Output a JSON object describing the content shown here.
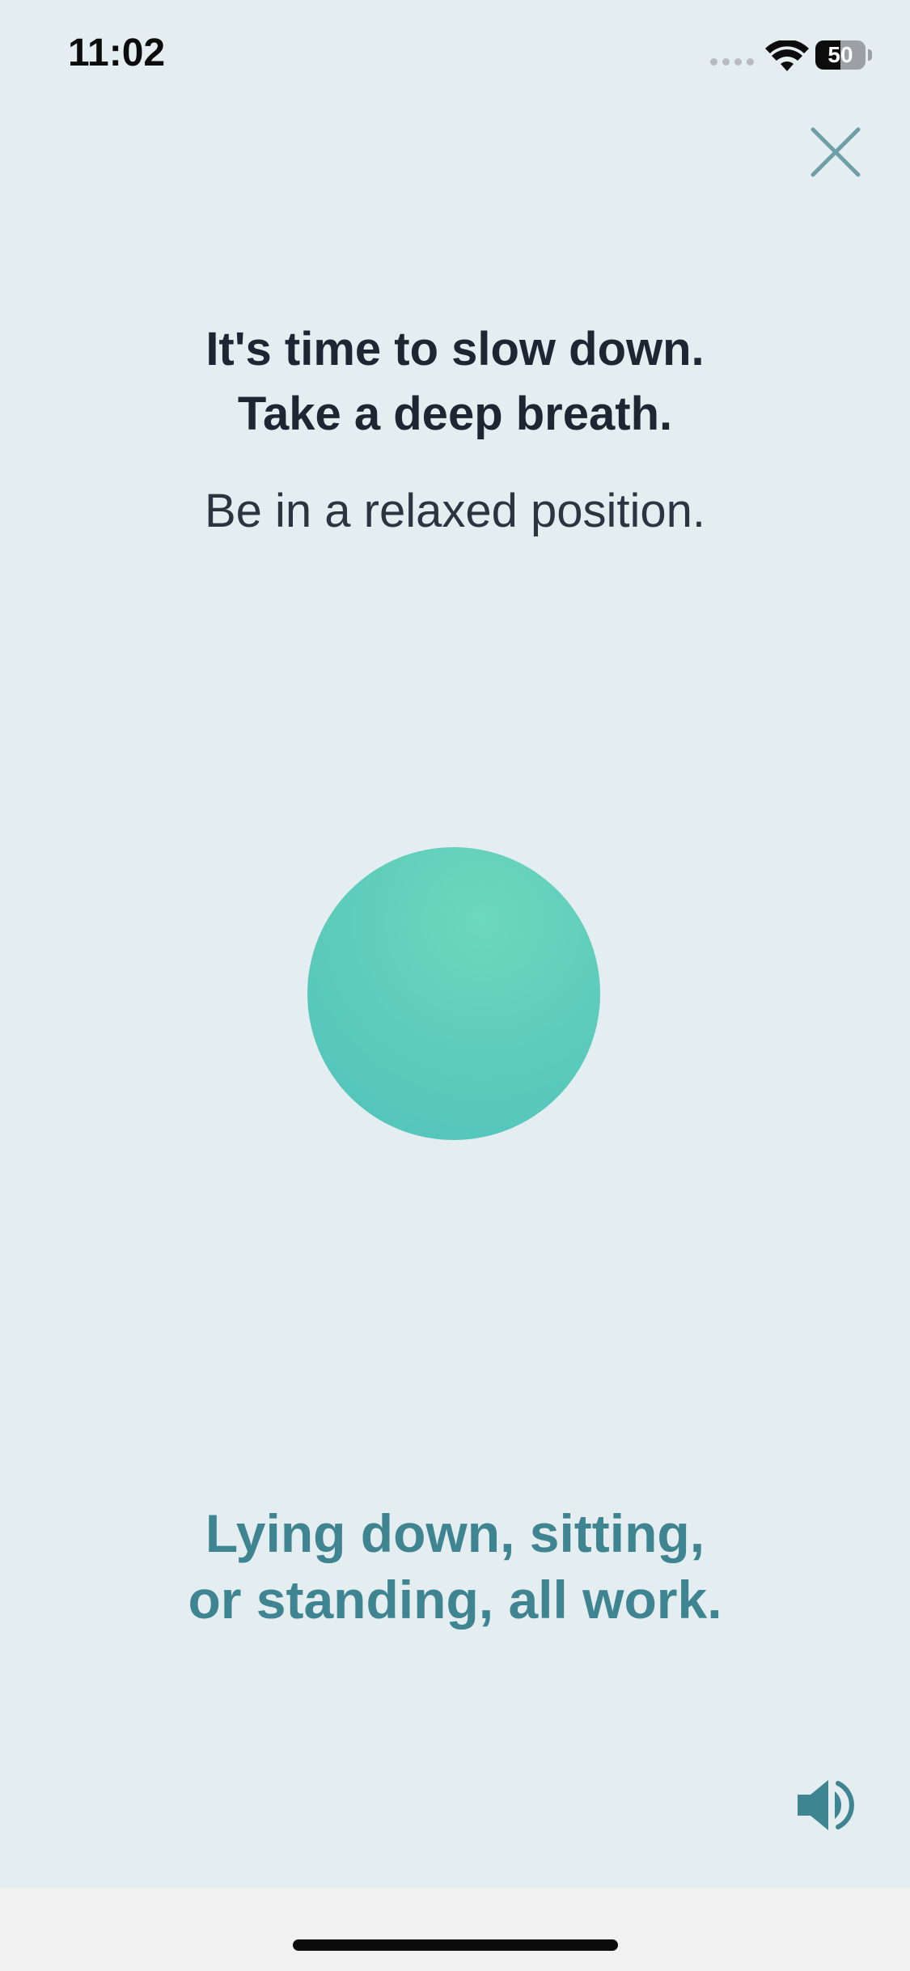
{
  "status_bar": {
    "time": "11:02",
    "battery_level": "50",
    "battery_fraction": 0.5,
    "icons": [
      "cellular-signal-icon",
      "wifi-icon",
      "battery-icon"
    ]
  },
  "header": {
    "close_icon": "close-icon"
  },
  "prompt": {
    "title_line1": "It's time to slow down.",
    "title_line2": "Take a deep breath.",
    "subtitle": "Be in a relaxed position."
  },
  "breathing": {
    "circle_color": "#5fcdbb"
  },
  "instruction": {
    "line1": "Lying down, sitting,",
    "line2": "or standing, all work."
  },
  "controls": {
    "sound_icon": "speaker-volume-icon"
  },
  "colors": {
    "background": "#e4edf0",
    "accent": "#3e8591",
    "heading": "#1d2733"
  }
}
